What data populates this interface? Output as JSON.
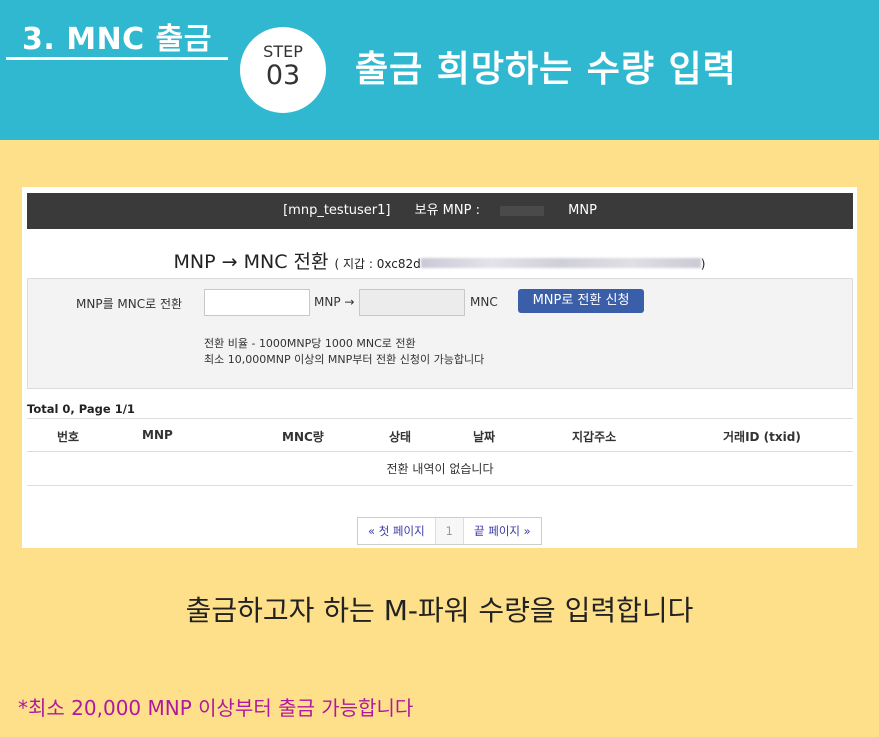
{
  "header": {
    "section_title": "3. MNC 출금",
    "step_label": "STEP",
    "step_number": "03",
    "title": "출금 희망하는 수량 입력"
  },
  "panel": {
    "topbar": {
      "username": "[mnp_testuser1]",
      "balance_label": "보유 MNP :",
      "balance_unit": "MNP"
    },
    "convert": {
      "title": "MNP → MNC 전환",
      "wallet_prefix": "( 지갑 : 0xc82d",
      "wallet_suffix": ")",
      "label": "MNP를 MNC로 전환",
      "mnp_unit": "MNP →",
      "mnc_unit": "MNC",
      "button": "MNP로 전환 신청",
      "notes": [
        "전환 비율 - 1000MNP당 1000 MNC로 전환",
        "최소 10,000MNP 이상의 MNP부터 전환 신청이 가능합니다"
      ]
    },
    "table": {
      "total": "Total 0, Page 1/1",
      "headers": [
        "번호",
        "MNP",
        "MNC량",
        "상태",
        "날짜",
        "지갑주소",
        "거래ID (txid)"
      ],
      "empty": "전환 내역이 없습니다"
    },
    "pager": {
      "first": "« 첫 페이지",
      "current": "1",
      "last": "끝 페이지 »"
    }
  },
  "body_text": "출금하고자 하는 M-파워 수량을 입력합니다",
  "note": "*최소 20,000 MNP 이상부터 출금 가능합니다",
  "colors": {
    "header_bg": "#2fb8cf",
    "page_bg": "#ffe08a",
    "button_bg": "#3b5ea8",
    "note_color": "#b0189f"
  }
}
